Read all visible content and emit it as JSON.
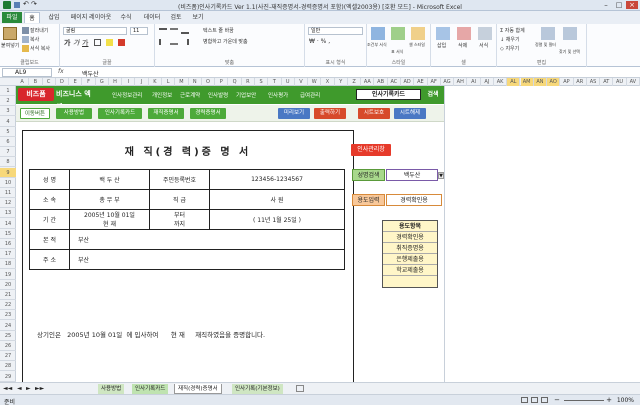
{
  "window": {
    "title": "(비즈폼)인사기록카드 Ver 1.1(사진-재직증명서-경력증명서 포함)(엑셀2003용) [호환 모드] - Microsoft Excel"
  },
  "ribbon_tabs": [
    "파일",
    "홈",
    "삽입",
    "페이지 레이아웃",
    "수식",
    "데이터",
    "검토",
    "보기"
  ],
  "ribbon": {
    "clipboard": {
      "label": "클립보드",
      "paste": "붙여넣기",
      "cut": "잘라내기",
      "copy": "복사",
      "format_painter": "서식 복사"
    },
    "font": {
      "label": "글꼴",
      "font_name": "굴림",
      "font_size": "11"
    },
    "alignment": {
      "label": "맞춤",
      "wrap": "텍스트 줄 바꿈",
      "merge": "병합하고 가운데 맞춤"
    },
    "number": {
      "label": "표시 형식",
      "format": "일반"
    },
    "styles": {
      "label": "스타일",
      "conditional": "조건부 서식",
      "table": "표 서식",
      "cell_styles": "셀 스타일"
    },
    "cells": {
      "label": "셀",
      "insert": "삽입",
      "delete": "삭제",
      "format": "서식"
    },
    "editing": {
      "label": "편집",
      "autosum": "자동 합계",
      "fill": "채우기",
      "clear": "지우기",
      "sort": "정렬 및 필터",
      "find": "찾기 및 선택"
    }
  },
  "formula_bar": {
    "name_box": "AL9",
    "fx": "fx",
    "value": "백두산"
  },
  "columns": [
    "A",
    "B",
    "C",
    "D",
    "E",
    "F",
    "G",
    "H",
    "I",
    "J",
    "K",
    "L",
    "M",
    "N",
    "O",
    "P",
    "Q",
    "R",
    "S",
    "T",
    "U",
    "V",
    "W",
    "X",
    "Y",
    "Z",
    "AA",
    "AB",
    "AC",
    "AD",
    "AE",
    "AF",
    "AG",
    "AH",
    "AI",
    "AJ",
    "AK",
    "AL",
    "AM",
    "AN",
    "AO",
    "AP",
    "AR",
    "AS",
    "AT",
    "AU",
    "AV"
  ],
  "rows": [
    "1",
    "2",
    "3",
    "4",
    "5",
    "6",
    "7",
    "8",
    "9",
    "10",
    "11",
    "12",
    "13",
    "14",
    "15",
    "16",
    "17",
    "18",
    "19",
    "20",
    "21",
    "22",
    "23",
    "24",
    "25",
    "26",
    "27",
    "28",
    "29"
  ],
  "topband": {
    "logo": "비즈폼",
    "logo2": "비즈니스 엑셀",
    "menu": [
      "인사정보관리",
      "개인정보",
      "근로계약",
      "인사발령",
      "기업보안",
      "인사평가",
      "급여관리"
    ],
    "search_value": "인사기록카드",
    "search_button": "검색"
  },
  "subband": {
    "label": "이동버튼",
    "buttons": [
      "사용방법",
      "인사기록카드",
      "재직증명서",
      "경력증명서"
    ],
    "actions": [
      "미리보기",
      "출력하기",
      "시트보호",
      "시트해제"
    ]
  },
  "certificate": {
    "title": "재 직(경 력)증 명 서",
    "rows": [
      {
        "label": "성 명",
        "name": "백  두  산",
        "id_label": "주민등록번호",
        "id_value": "123456-1234567"
      },
      {
        "label": "소 속",
        "dept": "총  무  부",
        "pos_label": "직  급",
        "pos_value": "사  원"
      },
      {
        "label": "기 간",
        "start": "2005년 10월 01일",
        "from": "부터",
        "current": "현   재",
        "to": "까지",
        "duration": "( 11년 1월 25일 )"
      },
      {
        "label": "본 적",
        "value": "부산"
      },
      {
        "label": "주 소",
        "value": "부산"
      }
    ],
    "statement": {
      "prefix": "상기인은",
      "date": "2005년 10월 01일",
      "middle": "에 입사하여",
      "current": "현   재",
      "suffix": "재직하였음을 증명합니다."
    }
  },
  "panel": {
    "hr_button": "인사관리창",
    "search_label": "성명검색",
    "search_value": "백두산",
    "purpose_label": "용도입력",
    "purpose_value": "경력확인용",
    "purpose_list_title": "용도항목",
    "purpose_list": [
      "경력확인용",
      "취직증명용",
      "은행제출용",
      "학교제출용",
      ""
    ]
  },
  "sheet_tabs": [
    "사용방법",
    "인사기록카드",
    "재직(경력)증명서",
    "인사기록(기본정보)"
  ],
  "status": {
    "ready": "준비",
    "zoom": "100%"
  },
  "colors": {
    "green": "#3f9a2c",
    "red": "#d8262c",
    "blue": "#4a78c4",
    "file_tab": "#2a8a3c"
  }
}
